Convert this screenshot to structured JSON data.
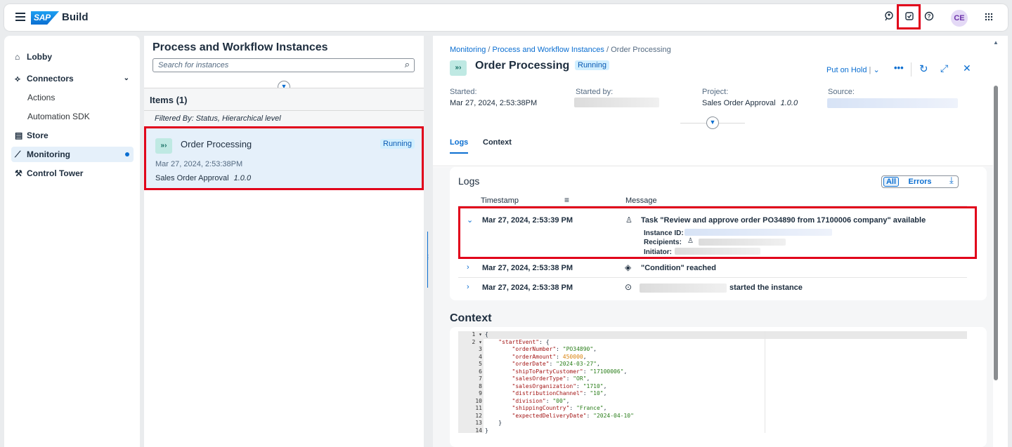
{
  "shell": {
    "logo_text": "SAP",
    "product": "Build",
    "icons": [
      "chat-user-icon",
      "inbox-check-icon",
      "help-icon",
      "grid-menu-icon"
    ],
    "avatar_initials": "CE"
  },
  "sidebar": {
    "items": [
      {
        "label": "Lobby",
        "icon": "home-icon"
      },
      {
        "label": "Connectors",
        "icon": "connector-icon"
      },
      {
        "label": "Actions"
      },
      {
        "label": "Automation SDK"
      },
      {
        "label": "Store",
        "icon": "store-icon"
      },
      {
        "label": "Monitoring",
        "icon": "chart-icon",
        "active": true
      },
      {
        "label": "Control Tower",
        "icon": "wrench-icon"
      }
    ]
  },
  "list": {
    "title": "Process and Workflow Instances",
    "search_placeholder": "Search for instances",
    "items_header": "Items (1)",
    "filter": "Filtered By: Status, Hierarchical level",
    "item": {
      "name": "Order Processing",
      "status": "Running",
      "date": "Mar 27, 2024, 2:53:38PM",
      "project": "Sales Order Approval",
      "version": "1.0.0"
    }
  },
  "detail": {
    "breadcrumb": [
      "Monitoring",
      "Process and Workflow Instances",
      "Order Processing"
    ],
    "title": "Order Processing",
    "status": "Running",
    "actions": {
      "hold": "Put on Hold"
    },
    "started_label": "Started:",
    "started_value": "Mar 27, 2024, 2:53:38PM",
    "started_by_label": "Started by:",
    "project_label": "Project:",
    "project_value": "Sales Order Approval",
    "project_version": "1.0.0",
    "source_label": "Source:",
    "tabs": [
      "Logs",
      "Context"
    ],
    "logs": {
      "title": "Logs",
      "filter_all": "All",
      "filter_errors": "Errors",
      "col_timestamp": "Timestamp",
      "col_message": "Message",
      "rows": [
        {
          "timestamp": "Mar 27, 2024, 2:53:39 PM",
          "message": "Task \"Review and approve order PO34890 from  17100006 company\" available",
          "instance_id_label": "Instance ID:",
          "recipients_label": "Recipients:",
          "initiator_label": "Initiator:"
        },
        {
          "timestamp": "Mar 27, 2024, 2:53:38 PM",
          "message": "\"Condition\" reached"
        },
        {
          "timestamp": "Mar 27, 2024, 2:53:38 PM",
          "message": "started the instance"
        }
      ]
    },
    "context": {
      "title": "Context",
      "line_numbers": [
        "1",
        "2",
        "3",
        "4",
        "5",
        "6",
        "7",
        "8",
        "9",
        "10",
        "11",
        "12",
        "13",
        "14"
      ],
      "lines": [
        "{",
        "    \"startEvent\": {",
        "        \"orderNumber\": \"PO34890\",",
        "        \"orderAmount\": 450000,",
        "        \"orderDate\": \"2024-03-27\",",
        "        \"shipToPartyCustomer\": \"17100006\",",
        "        \"salesOrderType\": \"OR\",",
        "        \"salesOrganization\": \"1710\",",
        "        \"distributionChannel\": \"10\",",
        "        \"division\": \"00\",",
        "        \"shippingCountry\": \"France\",",
        "        \"expectedDeliveryDate\": \"2024-04-10\"",
        "    }",
        "}"
      ]
    }
  }
}
